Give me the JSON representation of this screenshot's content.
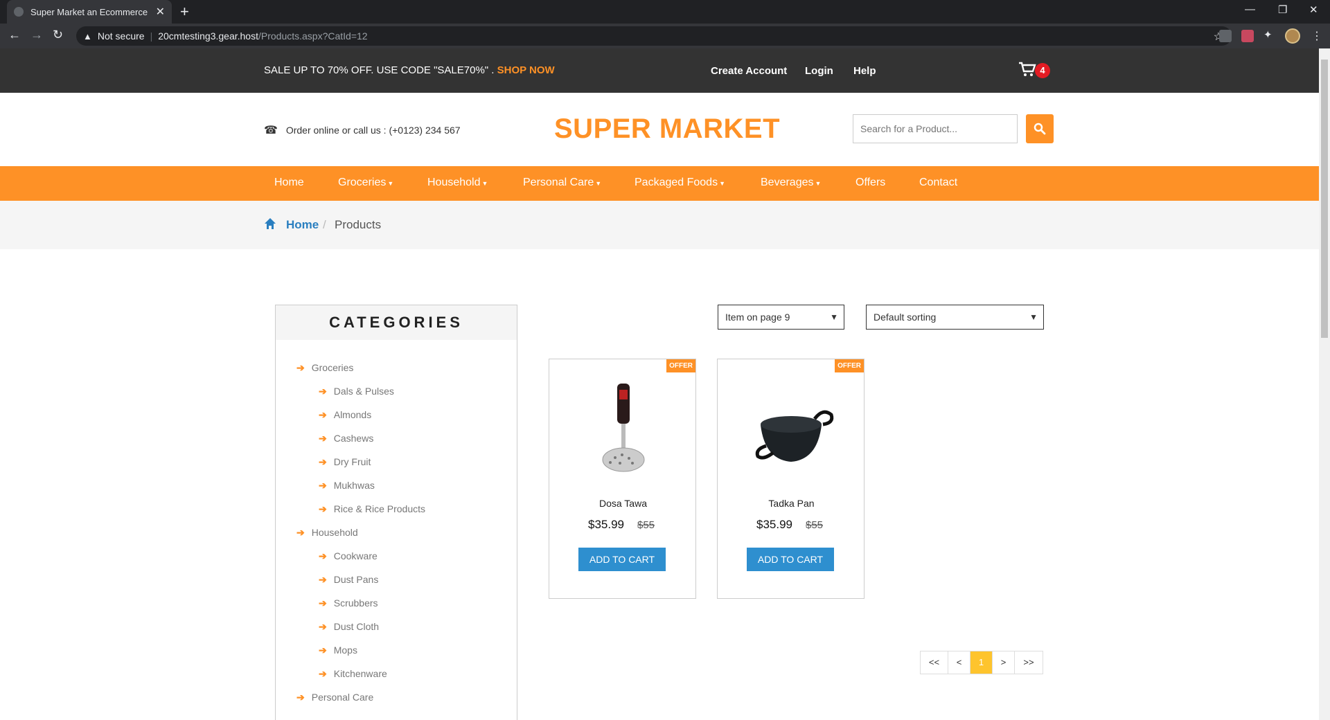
{
  "browser": {
    "tab_title": "Super Market an Ecommerce Onl",
    "security_label": "Not secure",
    "url_host": "20cmtesting3.gear.host",
    "url_path": "/Products.aspx?CatId=12"
  },
  "topbar": {
    "promo_text": "SALE UP TO 70% OFF. USE CODE \"SALE70%\" .",
    "promo_link": "SHOP NOW",
    "links": [
      "Create Account",
      "Login",
      "Help"
    ],
    "cart_count": "4"
  },
  "header": {
    "phone_text": "Order online or call us : (+0123) 234 567",
    "logo": "SUPER MARKET",
    "search_placeholder": "Search for a Product..."
  },
  "nav": {
    "items": [
      "Home",
      "Groceries",
      "Household",
      "Personal Care",
      "Packaged Foods",
      "Beverages",
      "Offers",
      "Contact"
    ]
  },
  "breadcrumb": {
    "home": "Home",
    "separator": "/",
    "current": "Products"
  },
  "sidebar": {
    "title": "CATEGORIES",
    "items": [
      "Groceries",
      "Dals & Pulses",
      "Almonds",
      "Cashews",
      "Dry Fruit",
      "Mukhwas",
      "Rice & Rice Products",
      "Household",
      "Cookware",
      "Dust Pans",
      "Scrubbers",
      "Dust Cloth",
      "Mops",
      "Kitchenware",
      "Personal Care"
    ]
  },
  "controls": {
    "per_page": "Item on page 9",
    "sorting": "Default sorting"
  },
  "products": [
    {
      "badge": "OFFER",
      "name": "Dosa Tawa",
      "price": "$35.99",
      "old_price": "$55",
      "button": "ADD TO CART"
    },
    {
      "badge": "OFFER",
      "name": "Tadka Pan",
      "price": "$35.99",
      "old_price": "$55",
      "button": "ADD TO CART"
    }
  ],
  "pagination": [
    "<<",
    "<",
    "1",
    ">",
    ">>"
  ],
  "colors": {
    "accent": "#fe9126",
    "link": "#2a7fc0",
    "button": "#2e8fcf",
    "topbar": "#333333",
    "page_active": "#fec42d"
  }
}
